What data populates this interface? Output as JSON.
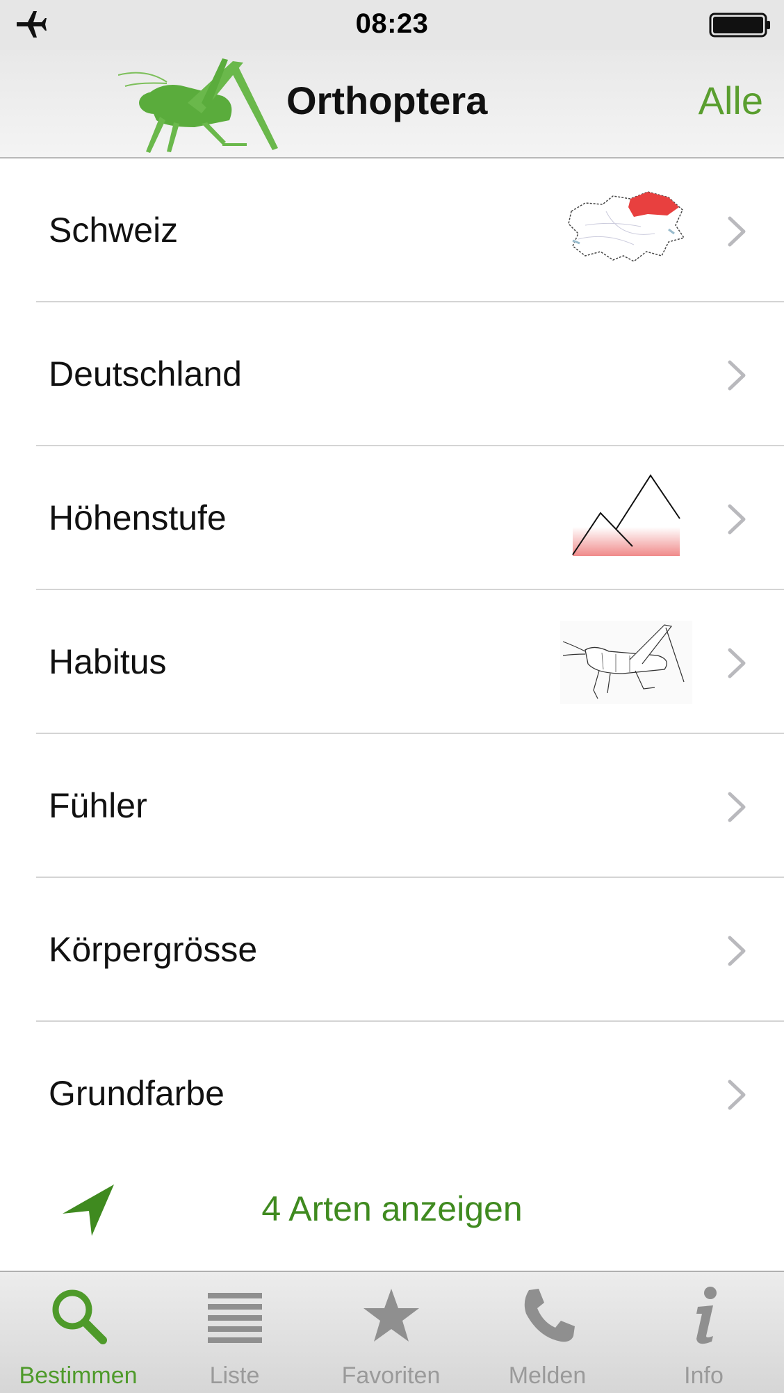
{
  "status_bar": {
    "time": "08:23",
    "airplane_icon": "airplane-icon",
    "battery_icon": "battery-icon"
  },
  "nav": {
    "title": "Orthoptera",
    "right_button": "Alle",
    "logo_icon": "grasshopper-logo",
    "accent_color": "#5a9e2f"
  },
  "list": {
    "items": [
      {
        "label": "Schweiz",
        "thumbnail": "switzerland-map"
      },
      {
        "label": "Deutschland",
        "thumbnail": ""
      },
      {
        "label": "Höhenstufe",
        "thumbnail": "mountains-altitude"
      },
      {
        "label": "Habitus",
        "thumbnail": "grasshopper-sketch"
      },
      {
        "label": "Fühler",
        "thumbnail": ""
      },
      {
        "label": "Körpergrösse",
        "thumbnail": ""
      },
      {
        "label": "Grundfarbe",
        "thumbnail": ""
      }
    ]
  },
  "action": {
    "label": "4 Arten anzeigen",
    "icon": "location-arrow-icon",
    "color": "#3f8a1f"
  },
  "tabbar": {
    "tabs": [
      {
        "label": "Bestimmen",
        "icon": "search-icon",
        "active": true
      },
      {
        "label": "Liste",
        "icon": "list-icon",
        "active": false
      },
      {
        "label": "Favoriten",
        "icon": "star-icon",
        "active": false
      },
      {
        "label": "Melden",
        "icon": "phone-icon",
        "active": false
      },
      {
        "label": "Info",
        "icon": "info-icon",
        "active": false
      }
    ],
    "active_color": "#4e9a2a",
    "inactive_color": "#9a9a9a"
  }
}
